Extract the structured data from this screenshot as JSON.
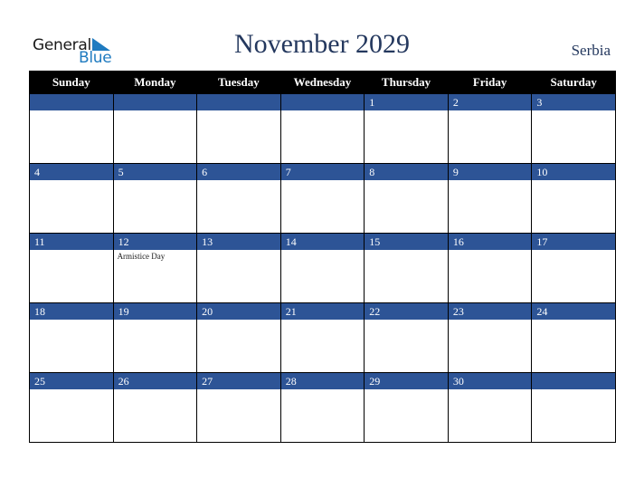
{
  "logo": {
    "general": "General",
    "blue": "Blue"
  },
  "title": "November 2029",
  "country": "Serbia",
  "weekdays": [
    "Sunday",
    "Monday",
    "Tuesday",
    "Wednesday",
    "Thursday",
    "Friday",
    "Saturday"
  ],
  "weeks": [
    [
      {
        "day": "",
        "event": ""
      },
      {
        "day": "",
        "event": ""
      },
      {
        "day": "",
        "event": ""
      },
      {
        "day": "",
        "event": ""
      },
      {
        "day": "1",
        "event": ""
      },
      {
        "day": "2",
        "event": ""
      },
      {
        "day": "3",
        "event": ""
      }
    ],
    [
      {
        "day": "4",
        "event": ""
      },
      {
        "day": "5",
        "event": ""
      },
      {
        "day": "6",
        "event": ""
      },
      {
        "day": "7",
        "event": ""
      },
      {
        "day": "8",
        "event": ""
      },
      {
        "day": "9",
        "event": ""
      },
      {
        "day": "10",
        "event": ""
      }
    ],
    [
      {
        "day": "11",
        "event": ""
      },
      {
        "day": "12",
        "event": "Armistice Day"
      },
      {
        "day": "13",
        "event": ""
      },
      {
        "day": "14",
        "event": ""
      },
      {
        "day": "15",
        "event": ""
      },
      {
        "day": "16",
        "event": ""
      },
      {
        "day": "17",
        "event": ""
      }
    ],
    [
      {
        "day": "18",
        "event": ""
      },
      {
        "day": "19",
        "event": ""
      },
      {
        "day": "20",
        "event": ""
      },
      {
        "day": "21",
        "event": ""
      },
      {
        "day": "22",
        "event": ""
      },
      {
        "day": "23",
        "event": ""
      },
      {
        "day": "24",
        "event": ""
      }
    ],
    [
      {
        "day": "25",
        "event": ""
      },
      {
        "day": "26",
        "event": ""
      },
      {
        "day": "27",
        "event": ""
      },
      {
        "day": "28",
        "event": ""
      },
      {
        "day": "29",
        "event": ""
      },
      {
        "day": "30",
        "event": ""
      },
      {
        "day": "",
        "event": ""
      }
    ]
  ],
  "colors": {
    "header_bg": "#000000",
    "strip_bg": "#2d5496",
    "title": "#24385e",
    "logo_blue": "#1f7bc0"
  }
}
